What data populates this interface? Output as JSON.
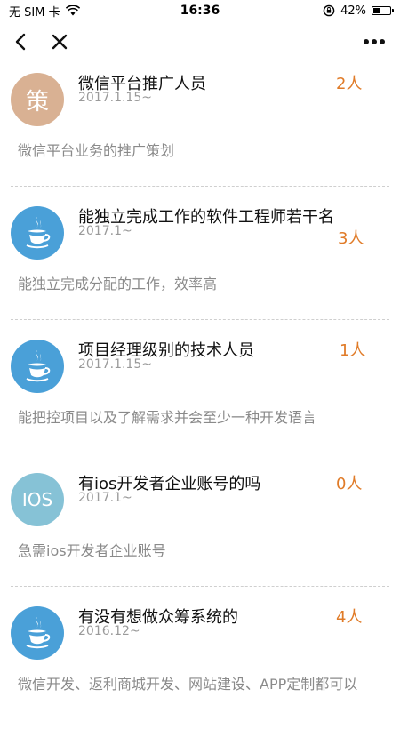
{
  "status_bar": {
    "carrier": "无 SIM 卡",
    "time": "16:36",
    "battery_text": "42%",
    "battery_level": 0.42
  },
  "nav": {
    "back_icon": "chevron-left-icon",
    "close_icon": "close-icon",
    "more_icon": "more-dots-icon"
  },
  "colors": {
    "accent": "#e07b28",
    "avatar_java": "#4aa0d8",
    "avatar_ios": "#86c2d6",
    "avatar_ce": "#d9b193"
  },
  "items": [
    {
      "avatar_text": "策",
      "avatar_type": "text",
      "title": "微信平台推广人员",
      "date": "2017.1.15~",
      "count": "2人",
      "desc": "微信平台业务的推广策划"
    },
    {
      "avatar_text": "",
      "avatar_type": "java-icon",
      "title": "能独立完成工作的软件工程师若干名",
      "date": "2017.1~",
      "count": "3人",
      "desc": "能独立完成分配的工作，效率高"
    },
    {
      "avatar_text": "",
      "avatar_type": "java-icon",
      "title": "项目经理级别的技术人员",
      "date": "2017.1.15~",
      "count": "1人",
      "desc": "能把控项目以及了解需求并会至少一种开发语言"
    },
    {
      "avatar_text": "IOS",
      "avatar_type": "text",
      "title": "有ios开发者企业账号的吗",
      "date": "2017.1~",
      "count": "0人",
      "desc": "急需ios开发者企业账号"
    },
    {
      "avatar_text": "",
      "avatar_type": "java-icon",
      "title": "有没有想做众筹系统的",
      "date": "2016.12~",
      "count": "4人",
      "desc": "微信开发、返利商城开发、网站建设、APP定制都可以"
    }
  ]
}
